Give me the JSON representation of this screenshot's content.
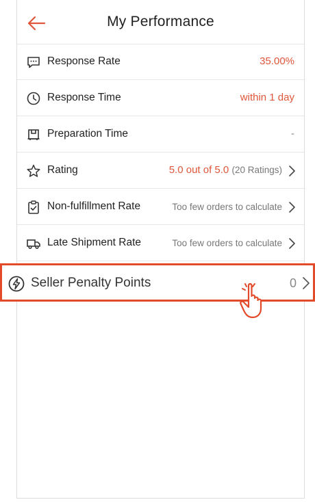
{
  "header": {
    "title": "My Performance",
    "back_icon": "arrow-left-icon",
    "accent": "#e0563a"
  },
  "rows": [
    {
      "icon": "chat-icon",
      "label": "Response Rate",
      "value": "35.00%"
    },
    {
      "icon": "clock-icon",
      "label": "Response Time",
      "value": "within 1 day"
    },
    {
      "icon": "box-icon",
      "label": "Preparation Time",
      "value": "-"
    },
    {
      "icon": "star-icon",
      "label": "Rating",
      "value": "5.0 out of 5.0",
      "sub": "(20 Ratings)"
    },
    {
      "icon": "clipboard-check-icon",
      "label": "Non-fulfillment Rate",
      "value": "Too few orders to calculate"
    },
    {
      "icon": "truck-icon",
      "label": "Late Shipment Rate",
      "value": "Too few orders to calculate"
    }
  ],
  "highlight": {
    "icon": "lightning-icon",
    "label": "Seller Penalty Points",
    "value": "0",
    "border_color": "#e24a2a"
  },
  "pointer": {
    "icon": "hand-pointer-icon"
  }
}
